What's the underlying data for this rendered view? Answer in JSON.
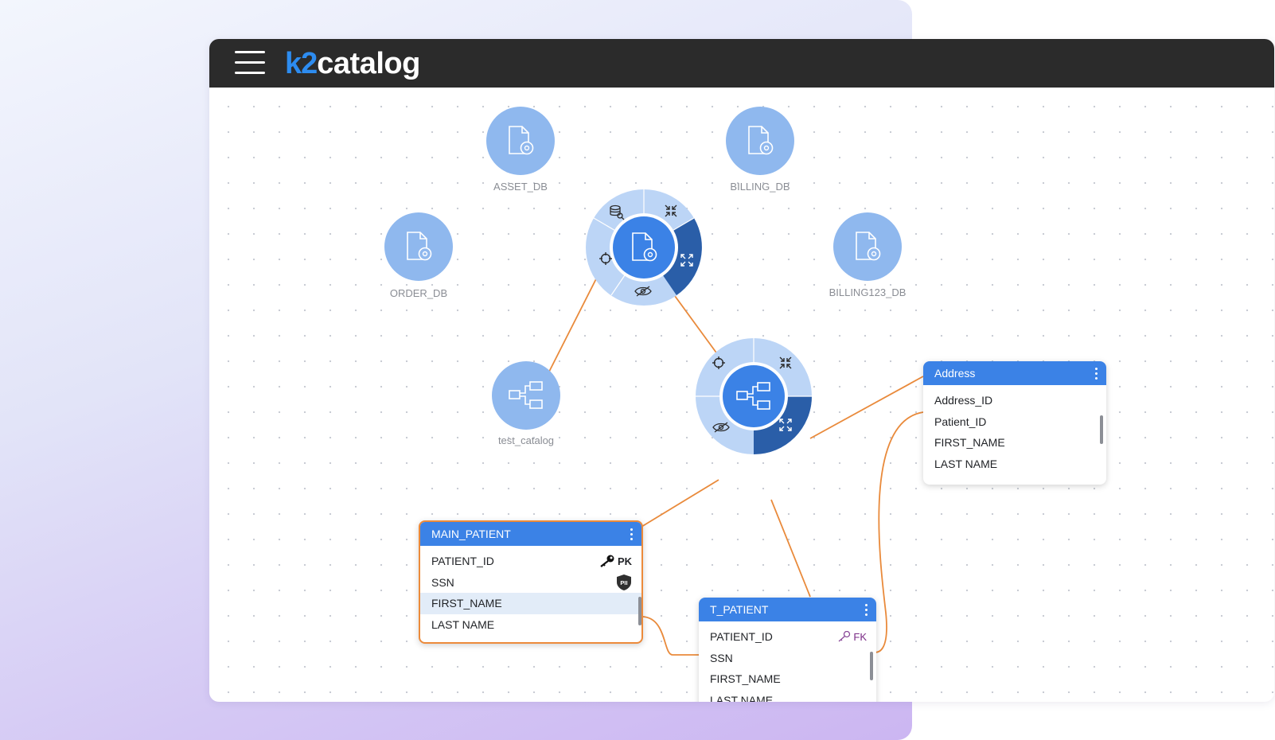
{
  "app": {
    "logo_k2": "k2",
    "logo_rest": "catalog"
  },
  "colors": {
    "edge": "#e98a3b",
    "node_light": "#8fb8ee",
    "node_active": "#3b82e6",
    "ring": "#bcd5f6",
    "ring_dark": "#2a5ea8",
    "header_bar": "#2b2b2b"
  },
  "nodes": [
    {
      "id": "asset_db",
      "label": "ASSET_DB",
      "icon": "file-gear-icon"
    },
    {
      "id": "billing_db",
      "label": "BILLING_DB",
      "icon": "file-gear-icon"
    },
    {
      "id": "order_db",
      "label": "ORDER_DB",
      "icon": "file-gear-icon"
    },
    {
      "id": "billing123_db",
      "label": "BILLING123_DB",
      "icon": "file-gear-icon"
    },
    {
      "id": "test_catalog",
      "label": "test_catalog",
      "icon": "schema-icon"
    }
  ],
  "radial_menus": [
    {
      "id": "db",
      "center_icon": "file-gear-icon",
      "actions": [
        "database-search-icon",
        "collapse-icon",
        "expand-icon",
        "hide-icon",
        "target-icon"
      ]
    },
    {
      "id": "schema",
      "center_icon": "schema-icon",
      "actions": [
        "target-icon",
        "collapse-icon",
        "expand-icon",
        "hide-icon"
      ]
    }
  ],
  "tables": {
    "address": {
      "title": "Address",
      "rows": [
        {
          "name": "Address_ID"
        },
        {
          "name": "Patient_ID"
        },
        {
          "name": "FIRST_NAME"
        },
        {
          "name": "LAST NAME"
        }
      ]
    },
    "main_patient": {
      "title": "MAIN_PATIENT",
      "rows": [
        {
          "name": "PATIENT_ID",
          "badge": "PK",
          "badge_icon": "key-icon"
        },
        {
          "name": "SSN",
          "badge_icon": "pii-shield-icon",
          "badge_icon_text": "PII"
        },
        {
          "name": "FIRST_NAME",
          "highlighted": true
        },
        {
          "name": "LAST NAME"
        }
      ]
    },
    "t_patient": {
      "title": "T_PATIENT",
      "rows": [
        {
          "name": "PATIENT_ID",
          "badge": "FK",
          "badge_icon": "foreign-key-icon"
        },
        {
          "name": "SSN"
        },
        {
          "name": "FIRST_NAME"
        },
        {
          "name": "LAST NAME"
        }
      ]
    }
  }
}
